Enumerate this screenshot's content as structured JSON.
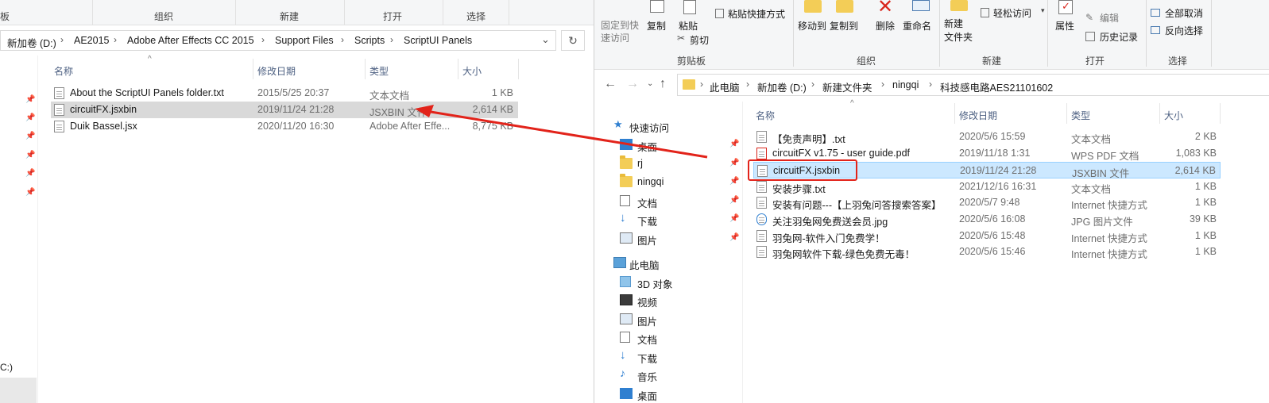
{
  "left": {
    "ribbon_groups": [
      "板",
      "组织",
      "新建",
      "打开",
      "选择"
    ],
    "breadcrumb": [
      "新加卷 (D:)",
      "AE2015",
      "Adobe After Effects CC 2015",
      "Support Files",
      "Scripts",
      "ScriptUI Panels"
    ],
    "columns": [
      "名称",
      "修改日期",
      "类型",
      "大小"
    ],
    "files": [
      {
        "name": "About the ScriptUI Panels folder.txt",
        "date": "2015/5/25 20:37",
        "type": "文本文档",
        "size": "1 KB"
      },
      {
        "name": "circuitFX.jsxbin",
        "date": "2019/11/24 21:28",
        "type": "JSXBIN 文件",
        "size": "2,614 KB"
      },
      {
        "name": "Duik Bassel.jsx",
        "date": "2020/11/20 16:30",
        "type": "Adobe After Effe...",
        "size": "8,775 KB"
      }
    ],
    "nav_bottom_label": "C:)"
  },
  "right": {
    "ribbon": {
      "pin_quick": "固定到快\n速访问",
      "copy": "复制",
      "paste": "粘贴",
      "paste_shortcut": "粘贴快捷方式",
      "cut": "剪切",
      "move_to": "移动到",
      "copy_to": "复制到",
      "delete": "删除",
      "rename": "重命名",
      "new_folder": "新建\n文件夹",
      "easy_access": "轻松访问",
      "properties": "属性",
      "edit": "编辑",
      "history": "历史记录",
      "select_none": "全部取消",
      "invert_select": "反向选择",
      "groups": [
        "剪贴板",
        "组织",
        "新建",
        "打开",
        "选择"
      ]
    },
    "breadcrumb": [
      "此电脑",
      "新加卷 (D:)",
      "新建文件夹",
      "ningqi",
      "科技感电路AES21101602"
    ],
    "tree": [
      {
        "label": "快速访问",
        "icon": "star-icon"
      },
      {
        "label": "桌面",
        "icon": "desktop-icon"
      },
      {
        "label": "rj",
        "icon": "folder-icon"
      },
      {
        "label": "ningqi",
        "icon": "folder-icon"
      },
      {
        "label": "文档",
        "icon": "document-icon"
      },
      {
        "label": "下载",
        "icon": "download-icon"
      },
      {
        "label": "图片",
        "icon": "picture-icon"
      },
      {
        "label": "此电脑",
        "icon": "pc-icon"
      },
      {
        "label": "3D 对象",
        "icon": "cube-icon"
      },
      {
        "label": "视频",
        "icon": "video-icon"
      },
      {
        "label": "图片",
        "icon": "picture-icon"
      },
      {
        "label": "文档",
        "icon": "document-icon"
      },
      {
        "label": "下载",
        "icon": "download-icon"
      },
      {
        "label": "音乐",
        "icon": "music-icon"
      },
      {
        "label": "桌面",
        "icon": "desktop-icon"
      }
    ],
    "columns": [
      "名称",
      "修改日期",
      "类型",
      "大小"
    ],
    "files": [
      {
        "name": "【免责声明】.txt",
        "date": "2020/5/6 15:59",
        "type": "文本文档",
        "size": "2 KB"
      },
      {
        "name": "circuitFX v1.75 - user guide.pdf",
        "date": "2019/11/18 1:31",
        "type": "WPS PDF 文档",
        "size": "1,083 KB"
      },
      {
        "name": "circuitFX.jsxbin",
        "date": "2019/11/24 21:28",
        "type": "JSXBIN 文件",
        "size": "2,614 KB"
      },
      {
        "name": "安装步骤.txt",
        "date": "2021/12/16 16:31",
        "type": "文本文档",
        "size": "1 KB"
      },
      {
        "name": "安装有问题---【上羽兔问答搜索答案】",
        "date": "2020/5/7 9:48",
        "type": "Internet 快捷方式",
        "size": "1 KB"
      },
      {
        "name": "关注羽兔网免费送会员.jpg",
        "date": "2020/5/6 16:08",
        "type": "JPG 图片文件",
        "size": "39 KB"
      },
      {
        "name": "羽兔网-软件入门免费学！",
        "date": "2020/5/6 15:48",
        "type": "Internet 快捷方式",
        "size": "1 KB"
      },
      {
        "name": "羽兔网软件下载-绿色免费无毒！",
        "date": "2020/5/6 15:46",
        "type": "Internet 快捷方式",
        "size": "1 KB"
      }
    ]
  },
  "colors": {
    "selection": "#cce8ff",
    "annotation": "#e2231a",
    "left_selection": "#d9d9d9"
  }
}
